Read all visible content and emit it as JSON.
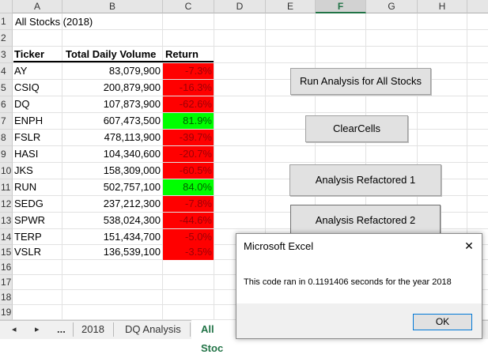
{
  "columns": [
    "A",
    "B",
    "C",
    "D",
    "E",
    "F",
    "G",
    "H"
  ],
  "selected_column": "F",
  "rows": [
    "1",
    "2",
    "3",
    "4",
    "5",
    "6",
    "7",
    "8",
    "9",
    "10",
    "11",
    "12",
    "13",
    "14",
    "15",
    "16",
    "17",
    "18",
    "19"
  ],
  "sheet_title": "All Stocks (2018)",
  "table": {
    "headers": [
      "Ticker",
      "Total Daily Volume",
      "Return"
    ],
    "rows": [
      {
        "ticker": "AY",
        "volume": "83,079,900",
        "ret": "-7.3%"
      },
      {
        "ticker": "CSIQ",
        "volume": "200,879,900",
        "ret": "-16.3%"
      },
      {
        "ticker": "DQ",
        "volume": "107,873,900",
        "ret": "-62.6%"
      },
      {
        "ticker": "ENPH",
        "volume": "607,473,500",
        "ret": "81.9%"
      },
      {
        "ticker": "FSLR",
        "volume": "478,113,900",
        "ret": "-39.7%"
      },
      {
        "ticker": "HASI",
        "volume": "104,340,600",
        "ret": "-20.7%"
      },
      {
        "ticker": "JKS",
        "volume": "158,309,000",
        "ret": "-60.5%"
      },
      {
        "ticker": "RUN",
        "volume": "502,757,100",
        "ret": "84.0%"
      },
      {
        "ticker": "SEDG",
        "volume": "237,212,300",
        "ret": "-7.8%"
      },
      {
        "ticker": "SPWR",
        "volume": "538,024,300",
        "ret": "-44.6%"
      },
      {
        "ticker": "TERP",
        "volume": "151,434,700",
        "ret": "-5.0%"
      },
      {
        "ticker": "VSLR",
        "volume": "136,539,100",
        "ret": "-3.5%"
      }
    ]
  },
  "buttons": {
    "run_all": "Run Analysis for All Stocks",
    "clear": "ClearCells",
    "refactored1": "Analysis Refactored 1",
    "refactored2": "Analysis Refactored 2"
  },
  "tabs": {
    "prev": "◂",
    "next": "▸",
    "more": "...",
    "items": [
      "2018",
      "DQ Analysis",
      "All Stoc"
    ]
  },
  "dialog": {
    "title": "Microsoft Excel",
    "close": "✕",
    "message": "This code ran in 0.1191406 seconds for the year 2018",
    "ok": "OK"
  },
  "colors": {
    "negative_fill": "#ff0000",
    "positive_fill": "#00ff00",
    "active_tab": "#217346"
  }
}
